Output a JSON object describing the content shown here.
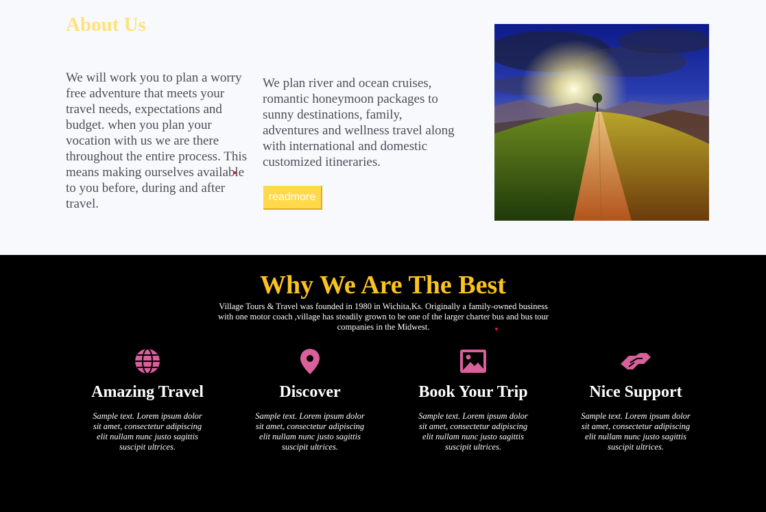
{
  "about": {
    "title": "About Us",
    "col1_text": "We will work you to plan a worry free adventure that meets your travel needs, expectations and budget. when you plan your vocation with us we are there throughout the entire process. This means making ourselves available to you before, during and after travel.",
    "col2_text": "We plan river and ocean cruises, romantic honeymoon packages to sunny destinations, family, adventures and wellness travel along with international and domestic customized itineraries.",
    "readmore_label": "readmore"
  },
  "why": {
    "title": "Why We Are The Best",
    "description": "Village Tours & Travel was founded in 1980 in Wichita,Ks. Originally a family-owned business with one motor coach ,village has steadily grown to be one of the larger charter bus and bus tour companies in the Midwest.",
    "features": [
      {
        "icon": "globe-icon",
        "title": "Amazing Travel",
        "text": "Sample text. Lorem ipsum dolor sit amet, consectetur adipiscing elit nullam nunc justo sagittis suscipit ultrices."
      },
      {
        "icon": "map-pin-icon",
        "title": "Discover",
        "text": "Sample text. Lorem ipsum dolor sit amet, consectetur adipiscing elit nullam nunc justo sagittis suscipit ultrices."
      },
      {
        "icon": "image-icon",
        "title": "Book Your Trip",
        "text": "Sample text. Lorem ipsum dolor sit amet, consectetur adipiscing elit nullam nunc justo sagittis suscipit ultrices."
      },
      {
        "icon": "handshake-icon",
        "title": "Nice Support",
        "text": "Sample text. Lorem ipsum dolor sit amet, consectetur adipiscing elit nullam nunc justo sagittis suscipit ultrices."
      }
    ]
  },
  "colors": {
    "about_title": "#ffe27a",
    "why_title": "#fbc223",
    "icon": "#d9609a",
    "button": "#ffd94a",
    "why_bg": "#000000",
    "about_bg": "#f8f9fd"
  }
}
